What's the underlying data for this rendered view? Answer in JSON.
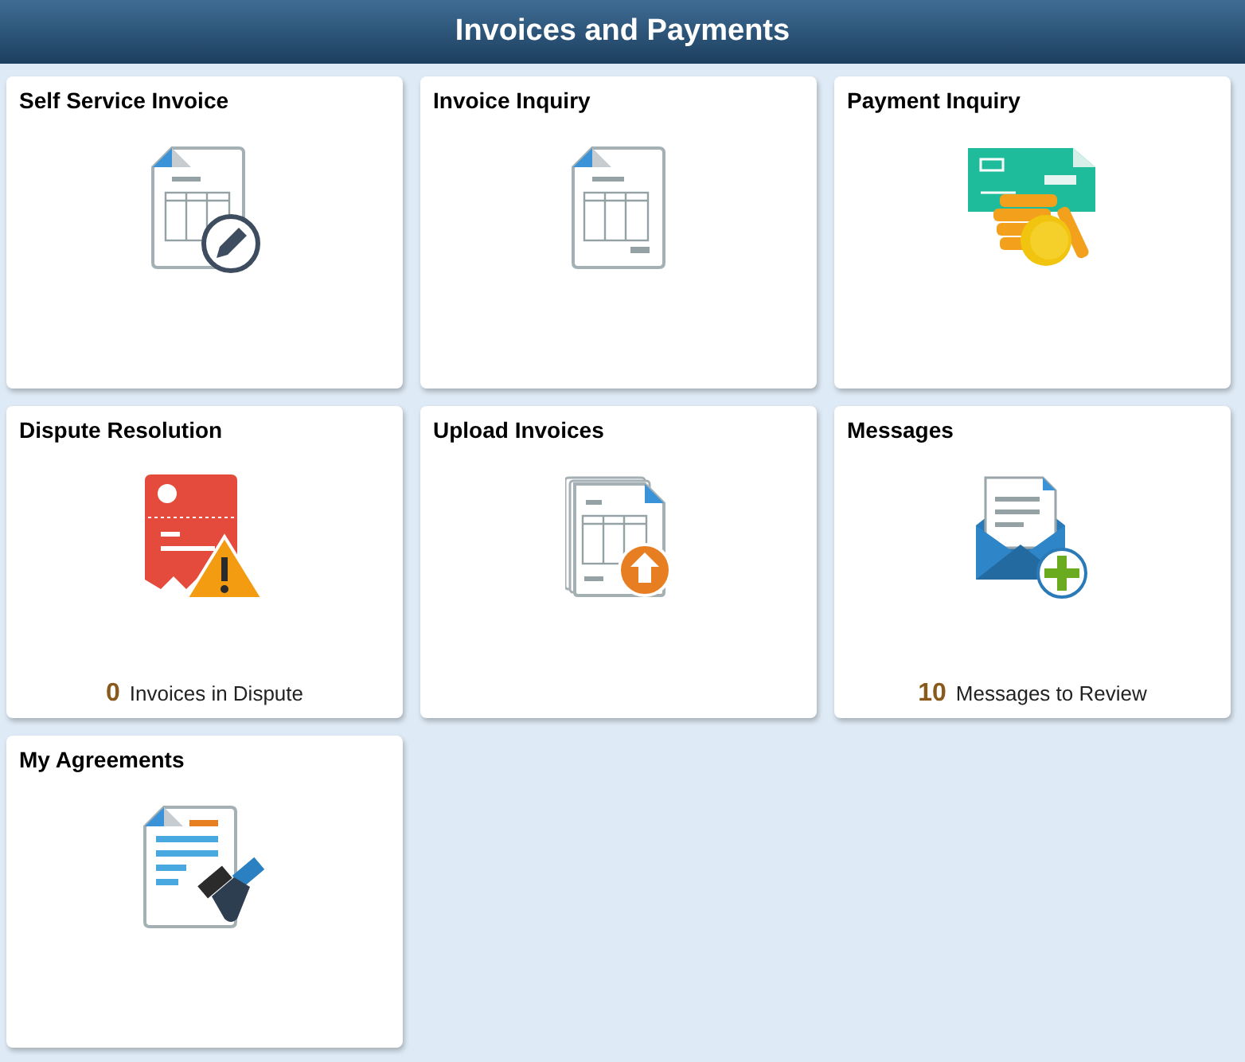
{
  "header": {
    "title": "Invoices and Payments"
  },
  "tiles": [
    {
      "title": "Self Service Invoice",
      "kind": "invoice-edit"
    },
    {
      "title": "Invoice Inquiry",
      "kind": "invoice"
    },
    {
      "title": "Payment Inquiry",
      "kind": "payment"
    },
    {
      "title": "Dispute Resolution",
      "kind": "dispute",
      "count": "0",
      "count_label": "Invoices in Dispute"
    },
    {
      "title": "Upload Invoices",
      "kind": "upload"
    },
    {
      "title": "Messages",
      "kind": "messages",
      "count": "10",
      "count_label": "Messages to Review"
    },
    {
      "title": "My Agreements",
      "kind": "agreement"
    }
  ]
}
